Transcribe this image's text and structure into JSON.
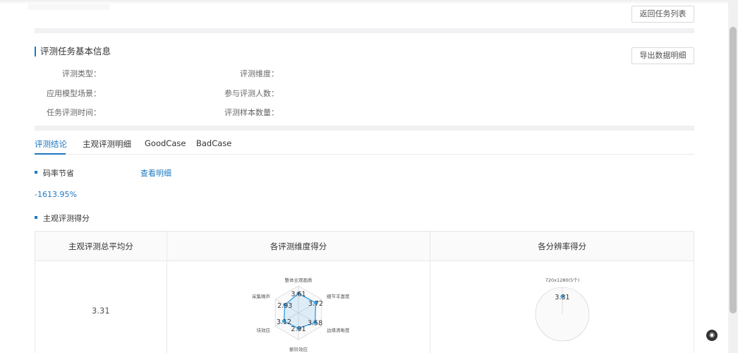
{
  "header": {
    "back_button": "返回任务列表",
    "export_button": "导出数据明细"
  },
  "basic_info": {
    "title": "评测任务基本信息",
    "fields": [
      {
        "label": "评测类型：",
        "value": ""
      },
      {
        "label": "评测维度：",
        "value": ""
      },
      {
        "label": "应用模型场景：",
        "value": ""
      },
      {
        "label": "参与评测人数：",
        "value": ""
      },
      {
        "label": "任务评测时间：",
        "value": ""
      },
      {
        "label": "评测样本数量：",
        "value": ""
      }
    ]
  },
  "tabs": [
    "评测结论",
    "主观评测明细",
    "GoodCase",
    "BadCase"
  ],
  "active_tab": "评测结论",
  "bitrate": {
    "title": "码率节省",
    "link": "查看明细",
    "value": "-1613.95%"
  },
  "subjective": {
    "title": "主观评测得分",
    "columns": [
      "主观评测总平均分",
      "各评测维度得分",
      "各分辨率得分"
    ],
    "average": "3.31"
  },
  "chart_data": [
    {
      "type": "radar",
      "indicators": [
        "整体主观画质",
        "细节丰富度",
        "边缘清晰度",
        "振铃效应",
        "块效应",
        "采集噪声"
      ],
      "values": [
        3.61,
        3.72,
        3.58,
        2.91,
        3.12,
        2.93
      ],
      "max": 5,
      "color": "#3ba0e6"
    },
    {
      "type": "radar",
      "indicators": [
        "720x1280(5个)"
      ],
      "values": [
        3.31
      ],
      "max": 5,
      "color": "#3ba0e6"
    }
  ],
  "colors": {
    "accent": "#1f78c1",
    "series": "#3ba0e6"
  },
  "corner_icon": "chrome-icon"
}
